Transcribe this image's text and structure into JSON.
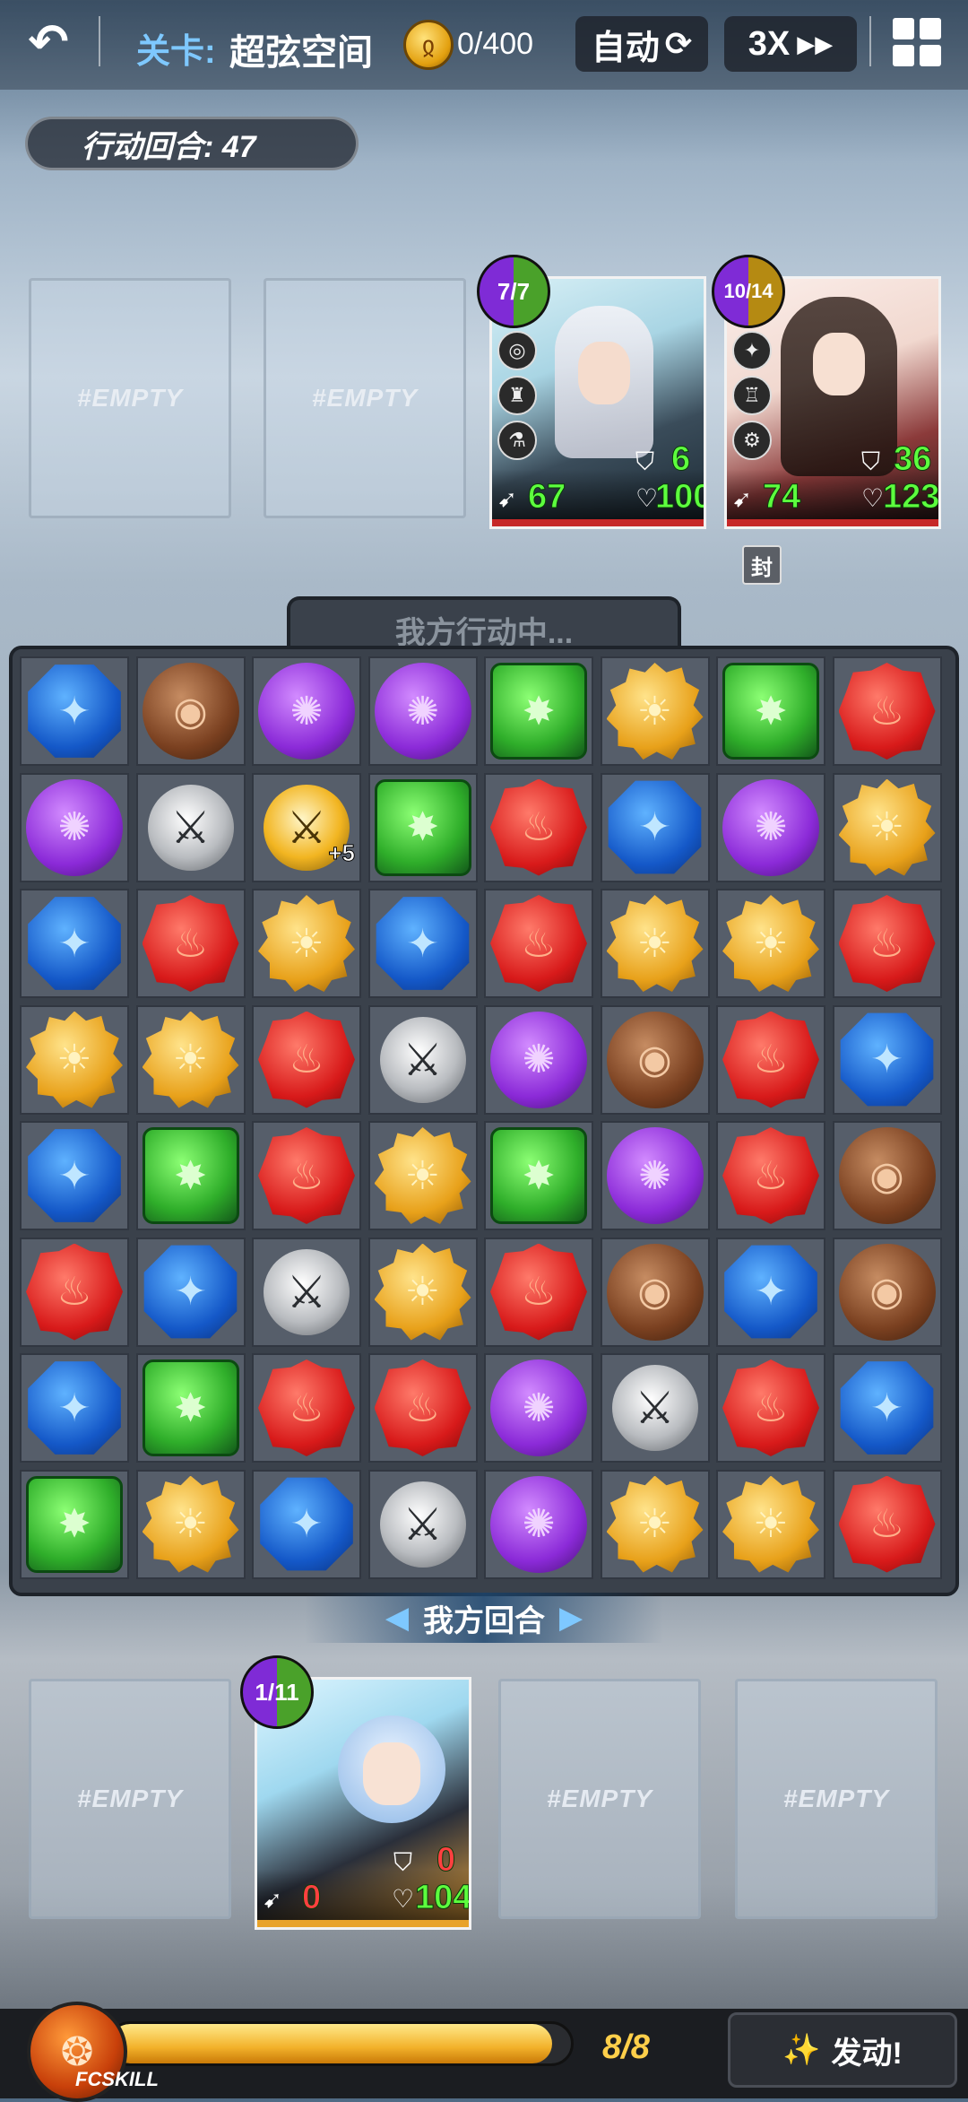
{
  "topbar": {
    "back_label": "↶",
    "level_prefix": "关卡:",
    "level_name": "超弦空间",
    "coin_icon": "gold-coin-icon",
    "coin_count": "0/400",
    "auto_label": "自动",
    "speed_label": "3X",
    "grid_icon": "grid-icon"
  },
  "round": {
    "label": "行动回合: 47"
  },
  "empty_label": "#EMPTY",
  "enemies": [
    {
      "badge": "7/7",
      "shield": "6",
      "attack": "67",
      "hp": "100",
      "badge_colors": [
        "#7f2bd6",
        "#4aa12a"
      ]
    },
    {
      "badge": "10/14",
      "shield": "36",
      "attack": "74",
      "hp": "123",
      "badge_colors": [
        "#7f2bd6",
        "#b58a12"
      ]
    }
  ],
  "seal_label": "封",
  "board": {
    "status": "我方行动中...",
    "turn_banner": "我方回合",
    "rows": [
      [
        "blue",
        "brown",
        "purple",
        "purple",
        "green",
        "yellow",
        "green",
        "red"
      ],
      [
        "purple",
        "sword",
        "sword-gold",
        "green",
        "red",
        "blue",
        "purple",
        "yellow"
      ],
      [
        "blue",
        "red",
        "yellow",
        "blue",
        "red",
        "yellow",
        "yellow",
        "red"
      ],
      [
        "yellow",
        "yellow",
        "red",
        "sword",
        "purple",
        "brown",
        "red",
        "blue"
      ],
      [
        "blue",
        "green",
        "red",
        "yellow",
        "green",
        "purple",
        "red",
        "brown"
      ],
      [
        "red",
        "blue",
        "sword",
        "yellow",
        "red",
        "brown",
        "blue",
        "brown"
      ],
      [
        "blue",
        "green",
        "red",
        "red",
        "purple",
        "sword",
        "red",
        "blue"
      ],
      [
        "green",
        "yellow",
        "blue",
        "sword",
        "purple",
        "yellow",
        "yellow",
        "red"
      ]
    ],
    "gold_sword_bonus": "+5"
  },
  "ally": {
    "badge": "1/11",
    "shield": "0",
    "attack": "0",
    "hp": "104"
  },
  "bottom": {
    "skill_label": "FCSKILL",
    "energy_text": "8/8",
    "energy_fraction": 0.96,
    "activate_label": "发动!",
    "activate_icon": "magic-wand-icon"
  }
}
